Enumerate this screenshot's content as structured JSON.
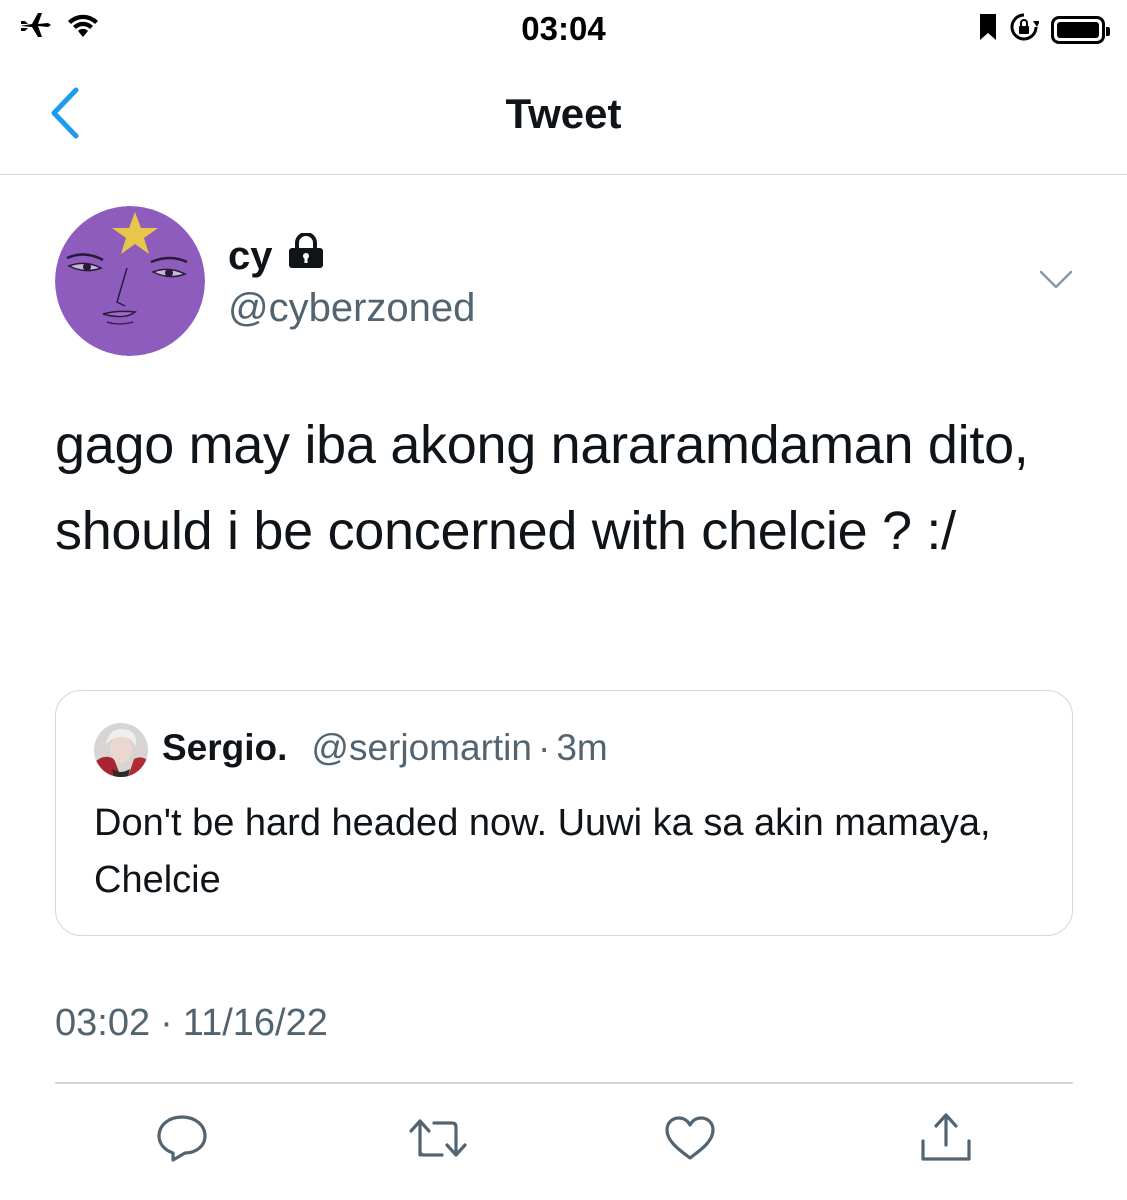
{
  "status_bar": {
    "time": "03:04",
    "icons": [
      "airplane-icon",
      "wifi-icon",
      "bookmark-icon",
      "rotation-lock-icon",
      "battery-icon"
    ]
  },
  "nav": {
    "title": "Tweet",
    "back_icon": "chevron-left-icon"
  },
  "tweet": {
    "display_name": "cy",
    "protected_icon": "lock-icon",
    "handle": "@cyberzoned",
    "text": "gago may iba akong nararamdaman dito, should i be concerned with chelcie ? :/",
    "more_icon": "chevron-down-icon",
    "timestamp_time": "03:02",
    "timestamp_sep": "·",
    "timestamp_date": "11/16/22"
  },
  "quote": {
    "name": "Sergio.",
    "handle": "@serjomartin",
    "dot": "·",
    "time": "3m",
    "text": "Don't be hard headed now. Uuwi ka sa akin mamaya, Chelcie"
  },
  "actions": [
    "reply-icon",
    "retweet-icon",
    "like-icon",
    "share-icon"
  ],
  "colors": {
    "accent": "#1d9bf0",
    "secondary_text": "#536471",
    "border": "#cfd9de",
    "avatar_purple": "#8e5cbd",
    "star": "#e8c64a"
  }
}
